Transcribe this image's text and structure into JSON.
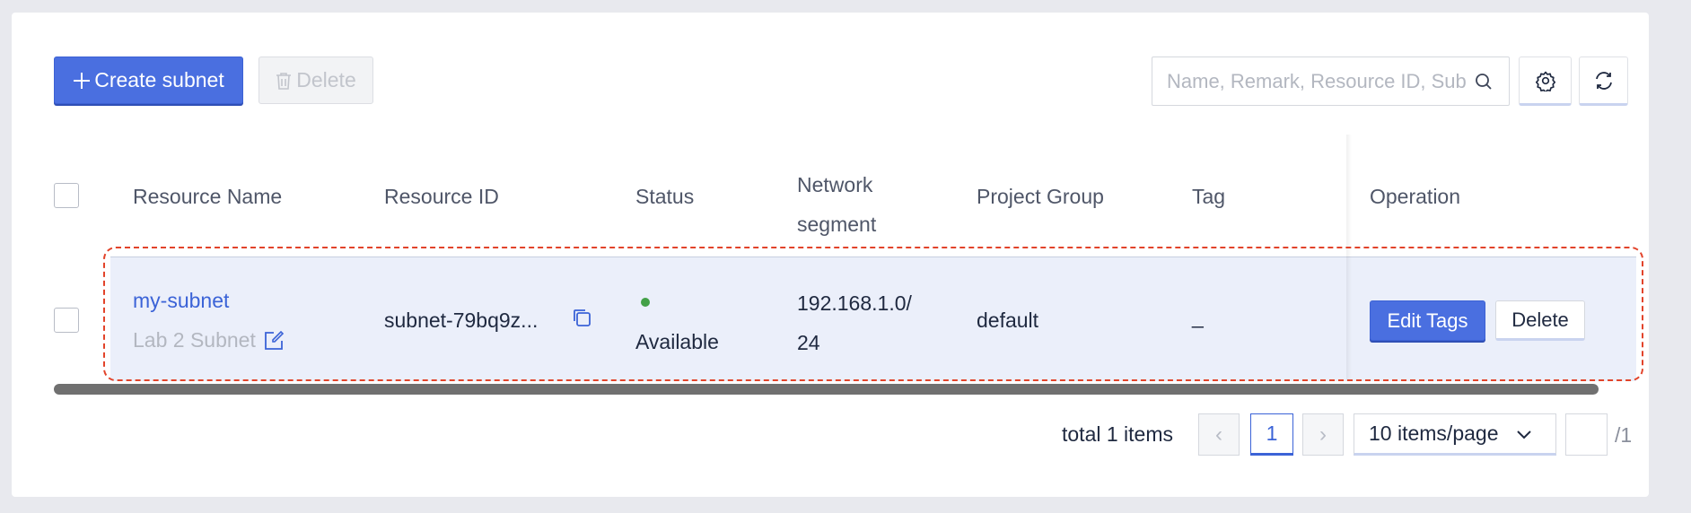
{
  "toolbar": {
    "create_label": "Create subnet",
    "delete_label": "Delete",
    "search_placeholder": "Name, Remark, Resource ID, Subnet"
  },
  "table": {
    "columns": {
      "resource_name": "Resource Name",
      "resource_id": "Resource ID",
      "status": "Status",
      "network_segment_line1": "Network",
      "network_segment_line2": "segment",
      "project_group": "Project Group",
      "tag": "Tag",
      "operation": "Operation"
    },
    "rows": [
      {
        "name": "my-subnet",
        "remark": "Lab 2 Subnet",
        "resource_id": "subnet-79bq9z...",
        "status": "Available",
        "segment_line1": "192.168.1.0/",
        "segment_line2": "24",
        "project_group": "default",
        "tag": "_",
        "edit_tags_label": "Edit Tags",
        "delete_label": "Delete"
      }
    ]
  },
  "pagination": {
    "total_text": "total 1 items",
    "prev": "‹",
    "current_page": "1",
    "next": "›",
    "page_size": "10 items/page",
    "total_pages": "/1"
  },
  "colors": {
    "primary": "#4a6fe0",
    "link": "#3b63d7",
    "status_ok": "#43a047",
    "highlight": "#e2432a"
  },
  "icons": [
    "plus-icon",
    "trash-icon",
    "search-icon",
    "gear-icon",
    "refresh-icon",
    "edit-icon",
    "copy-icon",
    "chevron-down-icon"
  ]
}
